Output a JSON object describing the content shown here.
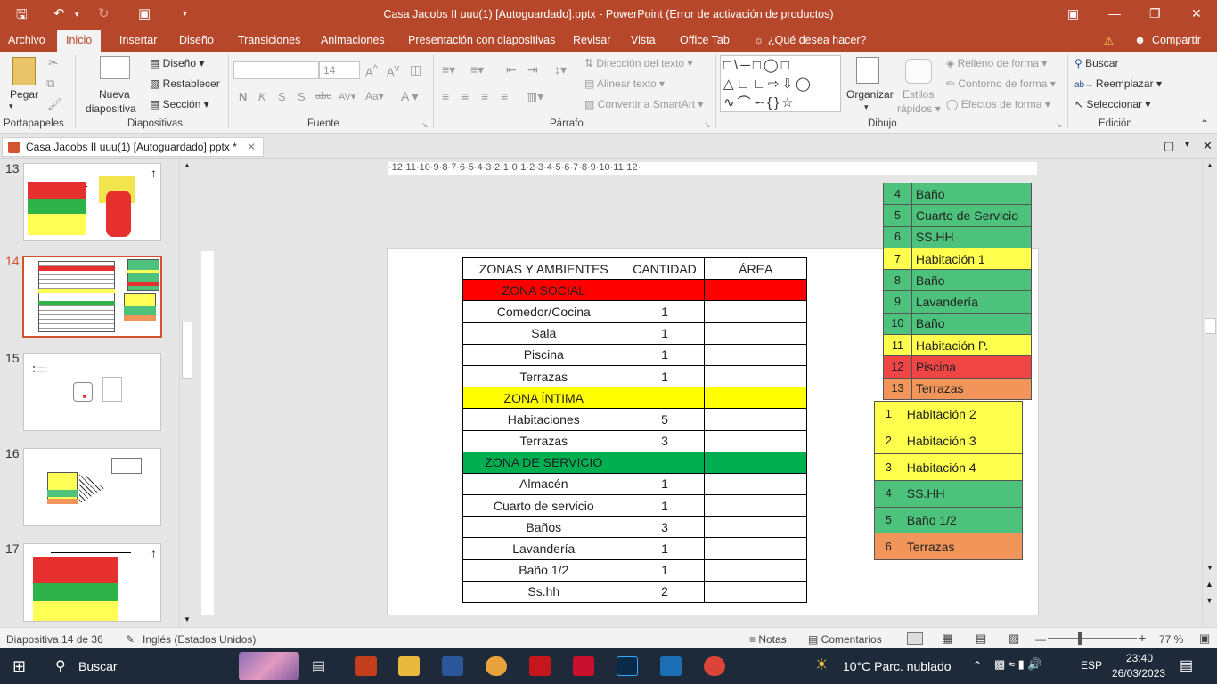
{
  "window": {
    "title": "Casa Jacobs II uuu(1) [Autoguardado].pptx - PowerPoint (Error de activación de productos)"
  },
  "tabs": [
    "Archivo",
    "Inicio",
    "Insertar",
    "Diseño",
    "Transiciones",
    "Animaciones",
    "Presentación con diapositivas",
    "Revisar",
    "Vista",
    "Office Tab"
  ],
  "tell_me": "¿Qué desea hacer?",
  "share": "Compartir",
  "ribbon": {
    "pegar": "Pegar",
    "nueva": "Nueva",
    "diapositiva": "diapositiva",
    "diseno": "Diseño",
    "restablecer": "Restablecer",
    "seccion": "Sección",
    "font_size": "14",
    "dir_texto": "Dirección del texto",
    "alinear_texto": "Alinear texto",
    "smartart": "Convertir a SmartArt",
    "organizar": "Organizar",
    "estilos": "Estilos",
    "rapidos": "rápidos",
    "relleno": "Relleno de forma",
    "contorno": "Contorno de forma",
    "efectos": "Efectos de forma",
    "buscar": "Buscar",
    "reemplazar": "Reemplazar",
    "seleccionar": "Seleccionar",
    "groups": [
      "Portapapeles",
      "Diapositivas",
      "Fuente",
      "Párrafo",
      "Dibujo",
      "Edición"
    ]
  },
  "doc_tab": "Casa Jacobs II uuu(1) [Autoguardado].pptx *",
  "thumbs": [
    "13",
    "14",
    "15",
    "16",
    "17"
  ],
  "ruler_text": "·12·11·10·9·8·7·6·5·4·3·2·1·0·1·2·3·4·5·6·7·8·9·10·11·12·",
  "main_table": {
    "headers": [
      "ZONAS Y AMBIENTES",
      "CANTIDAD",
      "ÁREA"
    ],
    "rows": [
      {
        "name": "ZONA SOCIAL",
        "qty": "",
        "type": "red"
      },
      {
        "name": "Comedor/Cocina",
        "qty": "1",
        "type": ""
      },
      {
        "name": "Sala",
        "qty": "1",
        "type": ""
      },
      {
        "name": "Piscina",
        "qty": "1",
        "type": ""
      },
      {
        "name": "Terrazas",
        "qty": "1",
        "type": ""
      },
      {
        "name": "ZONA ÍNTIMA",
        "qty": "",
        "type": "yellow"
      },
      {
        "name": "Habitaciones",
        "qty": "5",
        "type": ""
      },
      {
        "name": "Terrazas",
        "qty": "3",
        "type": ""
      },
      {
        "name": "ZONA DE SERVICIO",
        "qty": "",
        "type": "green"
      },
      {
        "name": "Almacén",
        "qty": "1",
        "type": ""
      },
      {
        "name": "Cuarto de servicio",
        "qty": "1",
        "type": ""
      },
      {
        "name": "Baños",
        "qty": "3",
        "type": ""
      },
      {
        "name": "Lavandería",
        "qty": "1",
        "type": ""
      },
      {
        "name": "Baño 1/2",
        "qty": "1",
        "type": ""
      },
      {
        "name": "Ss.hh",
        "qty": "2",
        "type": ""
      }
    ]
  },
  "right_table1": [
    {
      "n": "4",
      "name": "Baño",
      "c": "green"
    },
    {
      "n": "5",
      "name": "Cuarto de Servicio",
      "c": "green"
    },
    {
      "n": "6",
      "name": "SS.HH",
      "c": "green"
    },
    {
      "n": "7",
      "name": "Habitación 1",
      "c": "yellow"
    },
    {
      "n": "8",
      "name": "Baño",
      "c": "green"
    },
    {
      "n": "9",
      "name": "Lavandería",
      "c": "green"
    },
    {
      "n": "10",
      "name": "Baño",
      "c": "green"
    },
    {
      "n": "11",
      "name": "Habitación P.",
      "c": "yellow"
    },
    {
      "n": "12",
      "name": "Piscina",
      "c": "red"
    },
    {
      "n": "13",
      "name": "Terrazas",
      "c": "orange"
    }
  ],
  "right_table2": [
    {
      "n": "1",
      "name": "Habitación 2",
      "c": "yellow"
    },
    {
      "n": "2",
      "name": "Habitación 3",
      "c": "yellow"
    },
    {
      "n": "3",
      "name": "Habitación 4",
      "c": "yellow"
    },
    {
      "n": "4",
      "name": "SS.HH",
      "c": "green"
    },
    {
      "n": "5",
      "name": "Baño 1/2",
      "c": "green"
    },
    {
      "n": "6",
      "name": "Terrazas",
      "c": "orange"
    }
  ],
  "status": {
    "slide": "Diapositiva 14 de 36",
    "lang": "Inglés (Estados Unidos)",
    "notas": "Notas",
    "comentarios": "Comentarios",
    "zoom": "77 %"
  },
  "taskbar": {
    "search": "Buscar",
    "weather": "10°C  Parc. nublado",
    "lang": "ESP",
    "time": "23:40",
    "date": "26/03/2023"
  }
}
